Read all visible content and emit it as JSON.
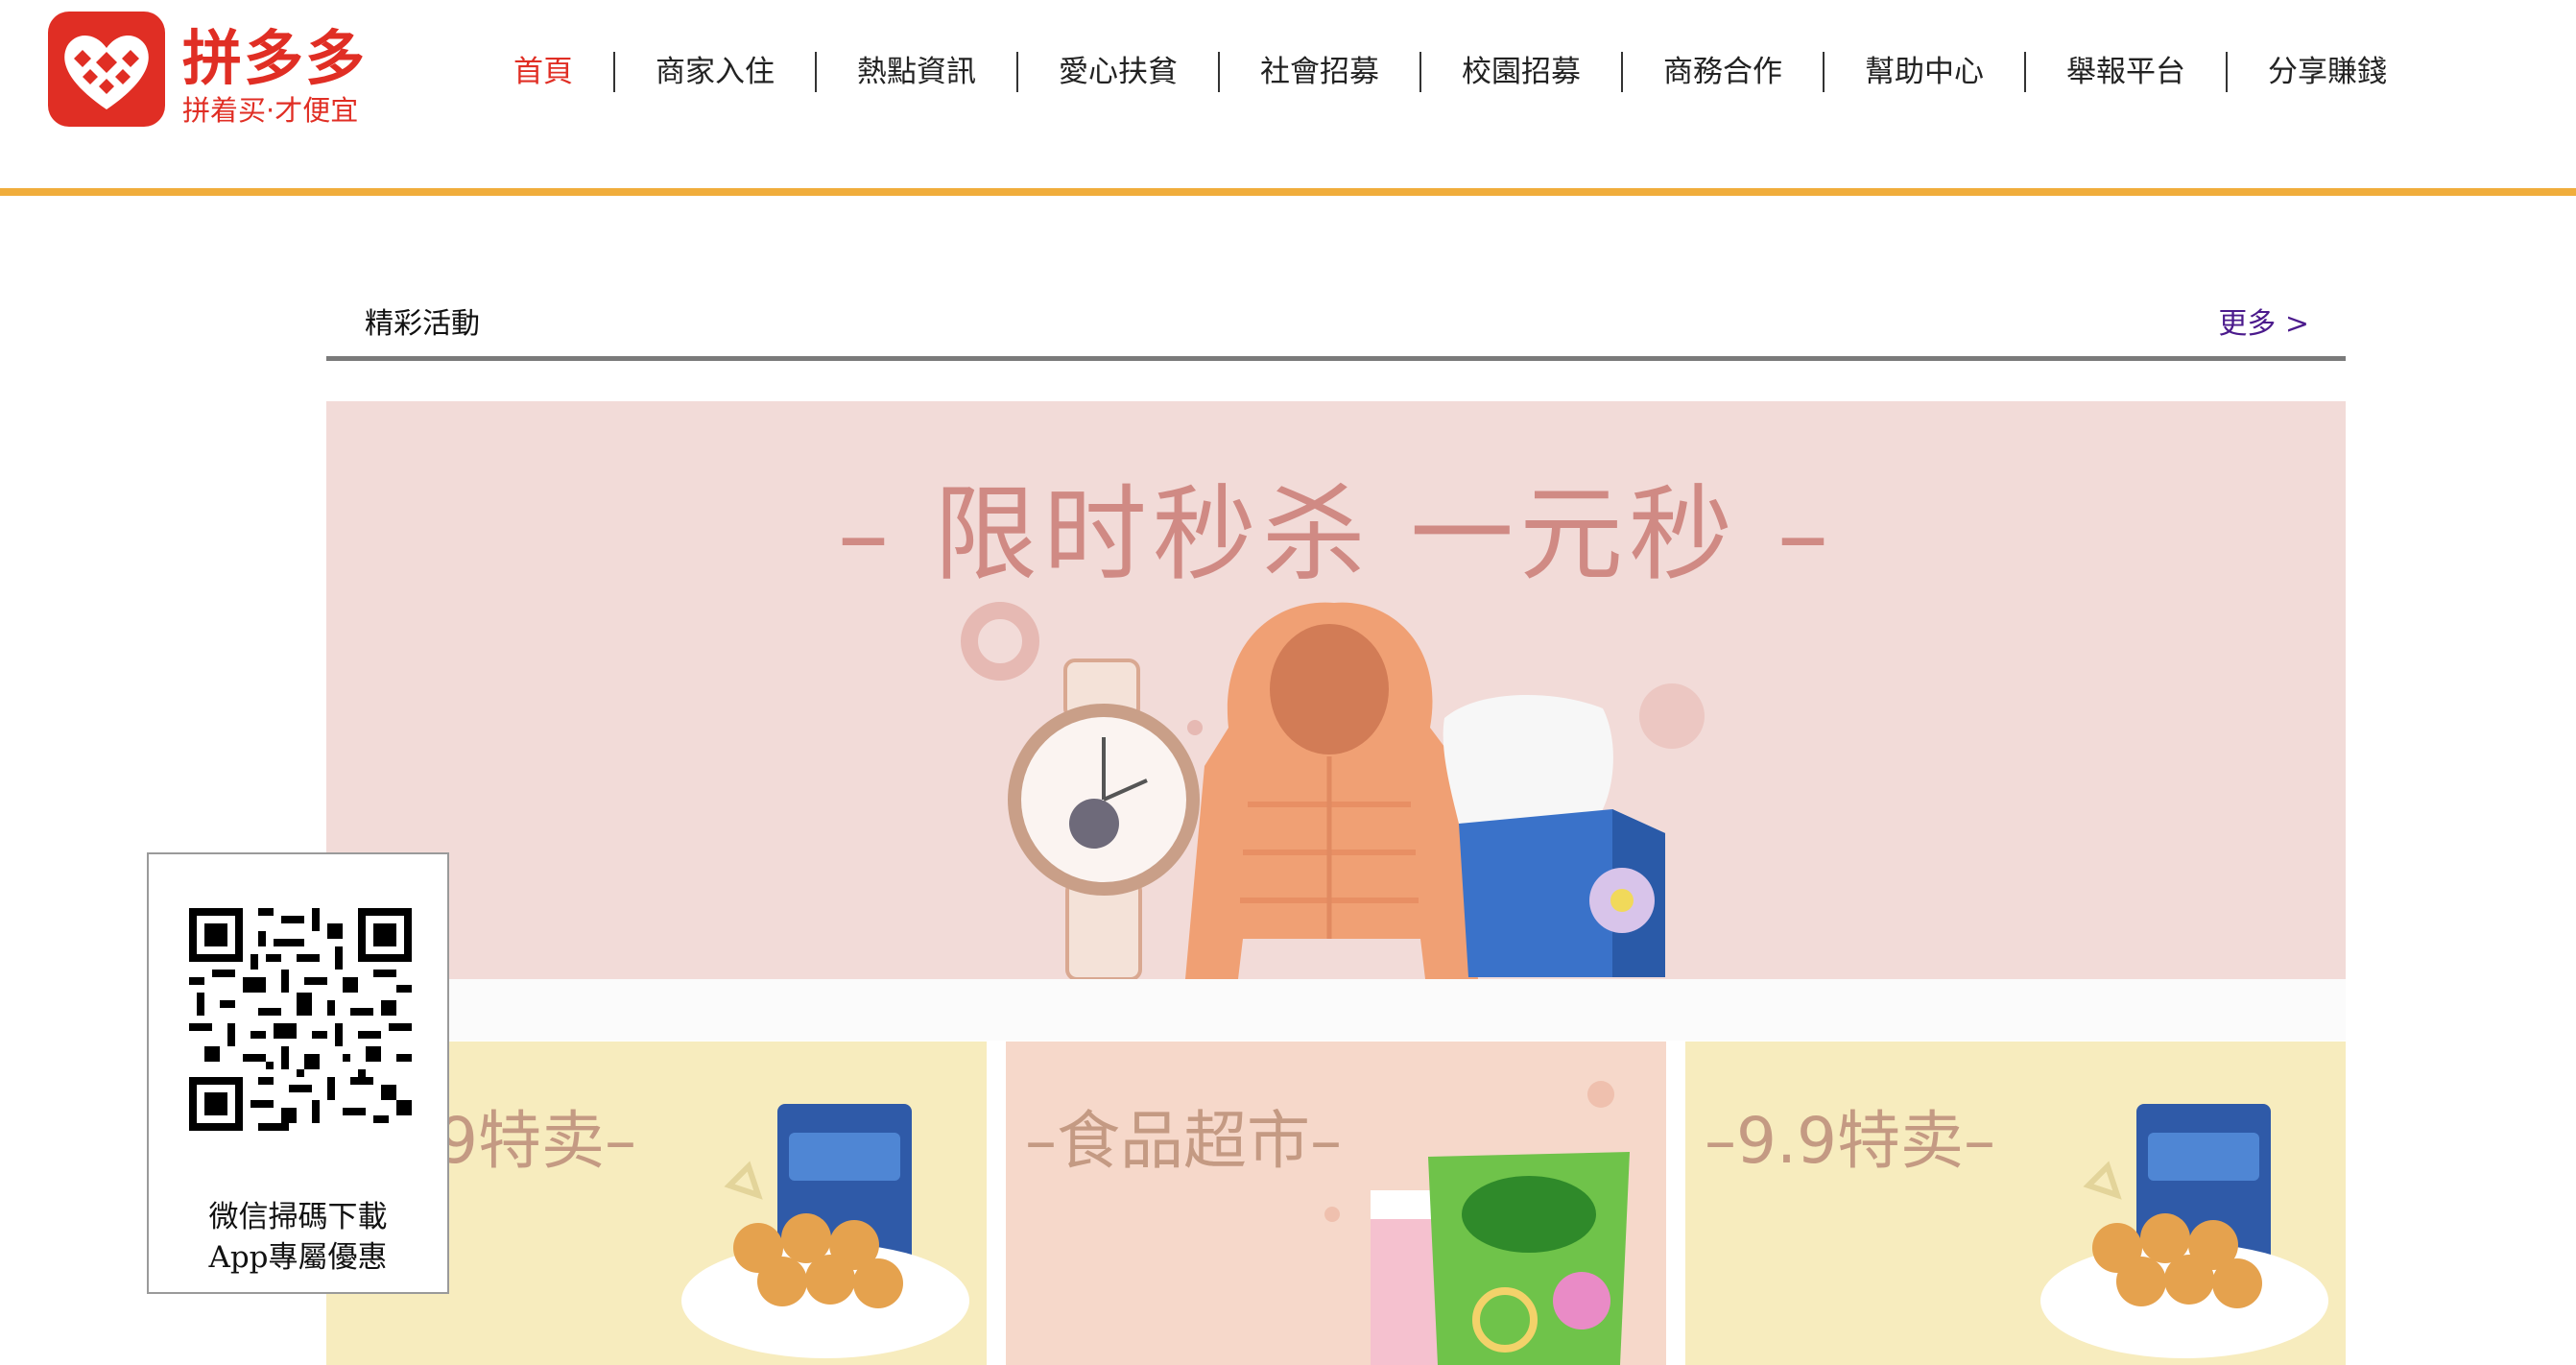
{
  "brand": {
    "name": "拼多多",
    "slogan": "拼着买·才便宜",
    "accent_color": "#e02e24",
    "logo_icon": "pinduoduo-heart-logo-icon"
  },
  "nav": {
    "items": [
      {
        "label": "首頁",
        "active": true
      },
      {
        "label": "商家入住",
        "active": false
      },
      {
        "label": "熱點資訊",
        "active": false
      },
      {
        "label": "愛心扶貧",
        "active": false
      },
      {
        "label": "社會招募",
        "active": false
      },
      {
        "label": "校園招募",
        "active": false
      },
      {
        "label": "商務合作",
        "active": false
      },
      {
        "label": "幫助中心",
        "active": false
      },
      {
        "label": "舉報平台",
        "active": false
      },
      {
        "label": "分享賺錢",
        "active": false
      }
    ],
    "bar_color": "#f0ad3c"
  },
  "section": {
    "title": "精彩活動",
    "more_label": "更多 >"
  },
  "hero": {
    "title": "– 限时秒杀 一元秒 –",
    "background": "#f2dbd8"
  },
  "cards": [
    {
      "title": "–9.9特卖–",
      "background": "#f7ecbe"
    },
    {
      "title": "–食品超市–",
      "background": "#f6d8ca"
    },
    {
      "title": "–9.9特卖–",
      "background": "#f7ecbe"
    }
  ],
  "qr": {
    "line1": "微信掃碼下載",
    "line2": "App專屬優惠",
    "icon": "qr-code-icon"
  }
}
